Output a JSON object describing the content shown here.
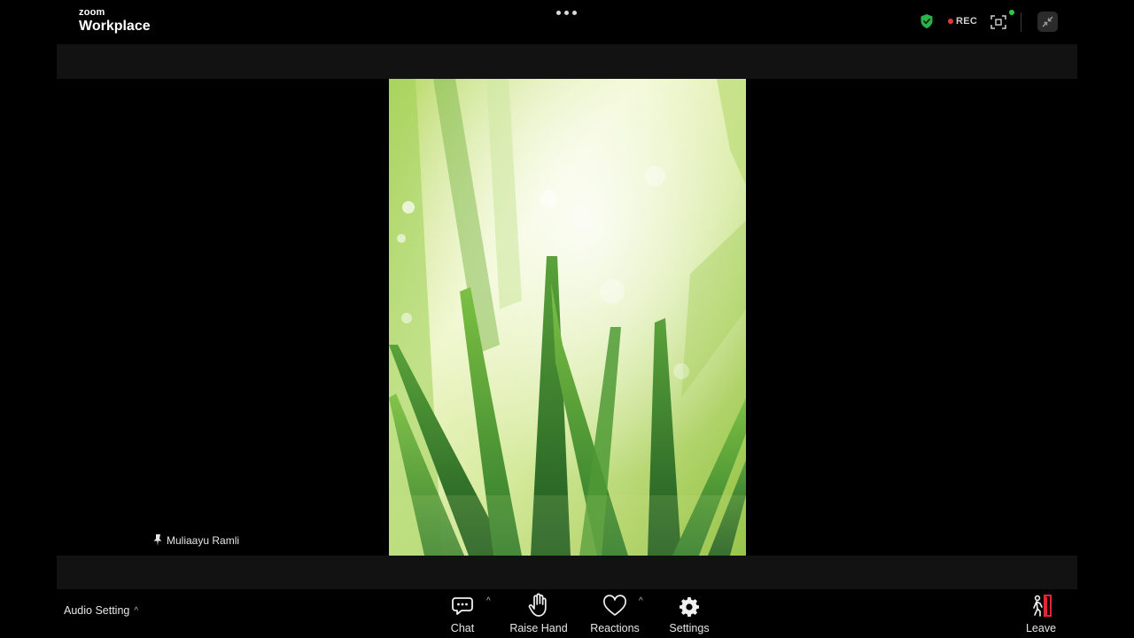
{
  "app": {
    "logo_small": "zoom",
    "logo_large": "Workplace"
  },
  "header": {
    "rec_label": "REC",
    "icons": [
      "more-options-icon",
      "security-shield-icon",
      "recording-dot-icon",
      "view-controls-icon",
      "exit-fullscreen-icon"
    ]
  },
  "video": {
    "participant_name": "Muliaayu Ramli"
  },
  "toolbar": {
    "audio_setting_label": "Audio Setting",
    "chat_label": "Chat",
    "raise_hand_label": "Raise Hand",
    "reactions_label": "Reactions",
    "settings_label": "Settings",
    "leave_label": "Leave"
  },
  "colors": {
    "background": "#000000",
    "band": "#121212",
    "shield_green": "#2bb34a",
    "rec_red": "#e53935",
    "status_green": "#2ecc40",
    "leave_red": "#e0263a"
  }
}
